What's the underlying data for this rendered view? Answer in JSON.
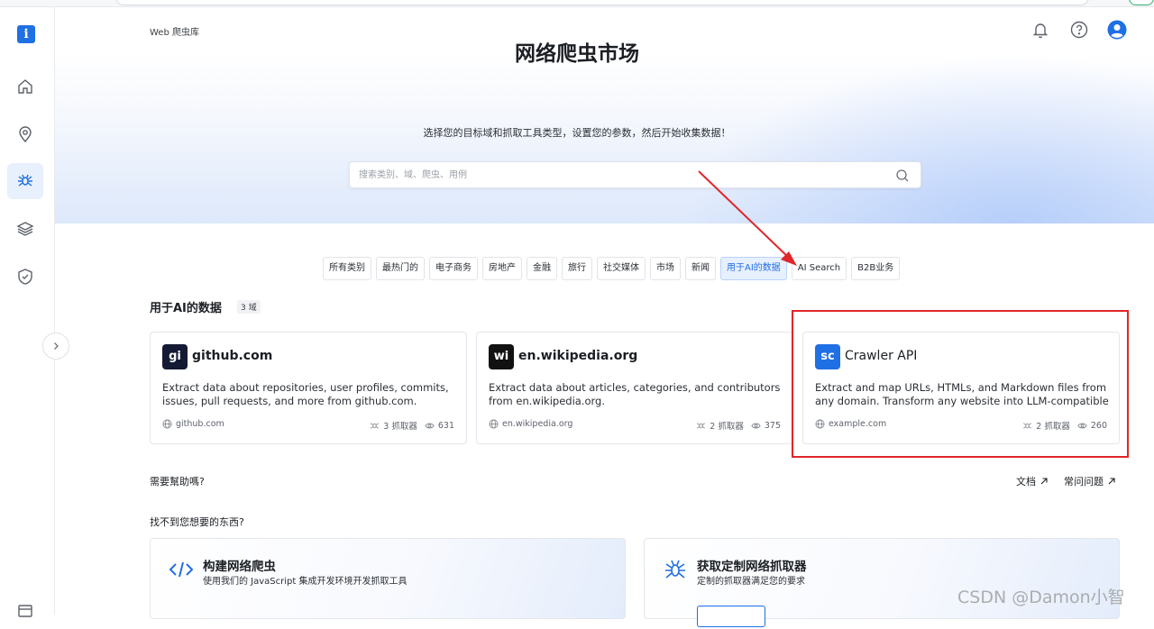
{
  "app": {
    "logo_letter": "i",
    "breadcrumb": "Web 爬虫库"
  },
  "sidebar": {
    "items": [
      {
        "name": "home-icon",
        "active": false
      },
      {
        "name": "location-pin-icon",
        "active": false
      },
      {
        "name": "spider-icon",
        "active": true
      },
      {
        "name": "layers-icon",
        "active": false
      },
      {
        "name": "shield-check-icon",
        "active": false
      },
      {
        "name": "window-icon",
        "active": false
      }
    ]
  },
  "header": {
    "icons": [
      "bell-icon",
      "help-circle-icon",
      "user-avatar-icon"
    ]
  },
  "hero": {
    "title": "网络爬虫市场",
    "subtitle": "选择您的目标域和抓取工具类型，设置您的参数，然后开始收集数据！",
    "search_placeholder": "搜索类别、域、爬虫、用例"
  },
  "tabs": [
    {
      "label": "所有类别",
      "active": false
    },
    {
      "label": "最热门的",
      "active": false
    },
    {
      "label": "电子商务",
      "active": false
    },
    {
      "label": "房地产",
      "active": false
    },
    {
      "label": "金融",
      "active": false
    },
    {
      "label": "旅行",
      "active": false
    },
    {
      "label": "社交媒体",
      "active": false
    },
    {
      "label": "市场",
      "active": false
    },
    {
      "label": "新闻",
      "active": false
    },
    {
      "label": "用于AI的数据",
      "active": true
    },
    {
      "label": "AI Search",
      "active": false
    },
    {
      "label": "B2B业务",
      "active": false
    }
  ],
  "section": {
    "title": "用于AI的数据",
    "count": "3 域"
  },
  "cards": [
    {
      "badge": "gi",
      "badge_color": "#141a33",
      "domain": "github.com",
      "description": "Extract data about repositories, user profiles, commits, issues, pull requests, and more from github.com.",
      "site": "github.com",
      "scrapers": "3 抓取器",
      "views": "631"
    },
    {
      "badge": "wi",
      "badge_color": "#111111",
      "domain": "en.wikipedia.org",
      "description": "Extract data about articles, categories, and contributors from en.wikipedia.org.",
      "site": "en.wikipedia.org",
      "scrapers": "2 抓取器",
      "views": "375"
    },
    {
      "badge": "sc",
      "badge_color": "#1f6fe5",
      "domain": "Crawler API",
      "description": "Extract and map URLs, HTMLs, and Markdown files from any domain. Transform any website into LLM-compatible …",
      "site": "example.com",
      "scrapers": "2 抓取器",
      "views": "260"
    }
  ],
  "help": {
    "question": "需要幫助嗎?",
    "docs": "文档",
    "faq": "常问问题",
    "not_found": "找不到您想要的东西?"
  },
  "promos": [
    {
      "icon": "code-icon",
      "title": "构建网络爬虫",
      "description": "使用我们的 JavaScript 集成开发环境开发抓取工具"
    },
    {
      "icon": "spider-icon",
      "title": "获取定制网络抓取器",
      "description": "定制的抓取器满足您的要求"
    }
  ],
  "watermark": "CSDN @Damon小智",
  "colors": {
    "accent": "#1f6fe5",
    "annotation_red": "#e0262a"
  }
}
